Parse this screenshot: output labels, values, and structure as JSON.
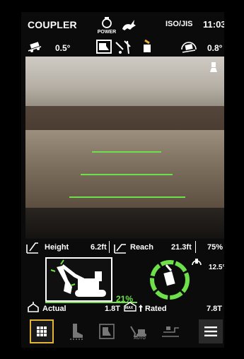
{
  "status": {
    "mode": "COUPLER",
    "power_label": "POWER",
    "standard": "ISO/JIS",
    "time": "11:03"
  },
  "angles": {
    "pitch": "0.5°",
    "roll": "0.8°"
  },
  "readouts": {
    "height_label": "Height",
    "height_value": "6.2ft",
    "reach_label": "Reach",
    "reach_value": "21.3ft",
    "percent": "75%"
  },
  "excavator": {
    "load_percent": "21%",
    "tilt": "12.5°"
  },
  "load": {
    "actual_label": "Actual",
    "actual_value": "1.8T",
    "max_label": "MAX",
    "rated_label": "Rated",
    "rated_value": "7.8T"
  },
  "nav": {
    "auto_label": "AUTO"
  },
  "colors": {
    "accent_green": "#6ee04a",
    "menu_border": "#e3b33a"
  }
}
